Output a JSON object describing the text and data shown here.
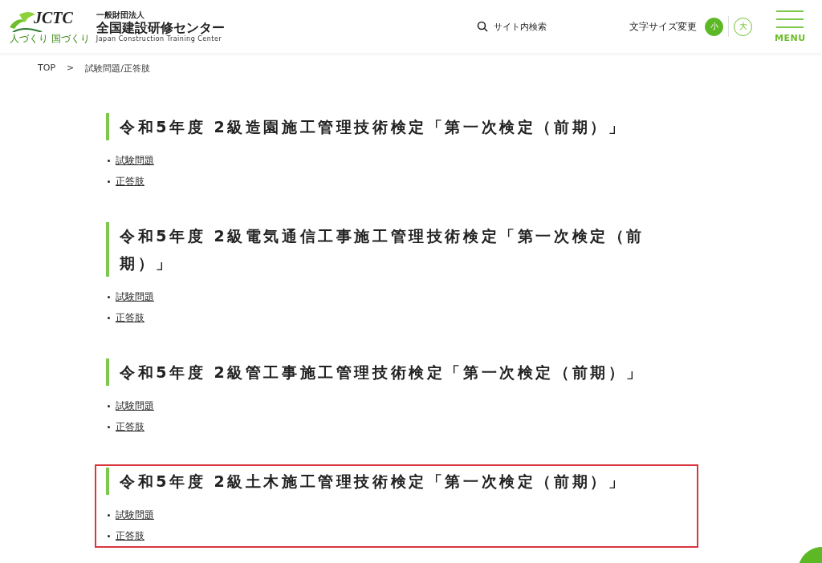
{
  "header": {
    "logo": {
      "mark": "JCTC",
      "tagline": "人づくり 国づくり",
      "org_type": "一般財団法人",
      "name": "全国建設研修センター",
      "name_en": "Japan Construction Training Center"
    },
    "search": {
      "label": "サイト内検索"
    },
    "font_size": {
      "label": "文字サイズ変更",
      "options": [
        {
          "label": "小",
          "selected": true
        },
        {
          "label": "大",
          "selected": false
        }
      ]
    },
    "menu": {
      "label": "MENU"
    }
  },
  "breadcrumb": {
    "separator": ">",
    "items": [
      {
        "label": "TOP"
      },
      {
        "label": "試験問題/正答肢"
      }
    ]
  },
  "sections": [
    {
      "title": "令和5年度 2級造園施工管理技術検定「第一次検定（前期）」",
      "highlighted": false,
      "links": [
        "試験問題",
        "正答肢"
      ]
    },
    {
      "title": "令和5年度 2級電気通信工事施工管理技術検定「第一次検定（前期）」",
      "highlighted": false,
      "links": [
        "試験問題",
        "正答肢"
      ]
    },
    {
      "title": "令和5年度 2級管工事施工管理技術検定「第一次検定（前期）」",
      "highlighted": false,
      "links": [
        "試験問題",
        "正答肢"
      ]
    },
    {
      "title": "令和5年度 2級土木施工管理技術検定「第一次検定（前期）」",
      "highlighted": true,
      "links": [
        "試験問題",
        "正答肢"
      ]
    }
  ]
}
